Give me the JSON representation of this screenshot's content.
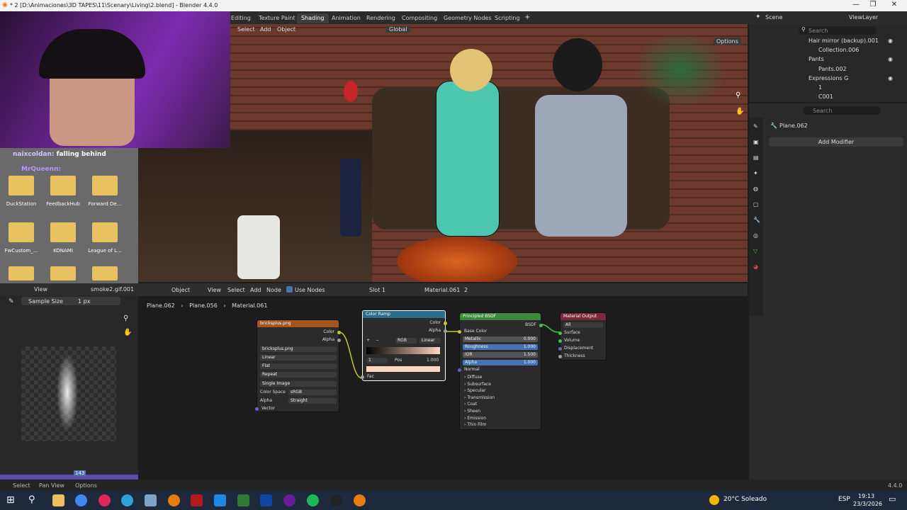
{
  "window": {
    "title": "* 2 [D:\\Animaciones\\3D TAPES\\11\\Scenary\\Living\\2.blend] - Blender 4.4.0"
  },
  "workspaces": [
    "Editing",
    "Texture Paint",
    "Shading",
    "Animation",
    "Rendering",
    "Compositing",
    "Geometry Nodes",
    "Scripting"
  ],
  "active_workspace": "Shading",
  "scene": {
    "scene_label": "Scene",
    "viewlayer_label": "ViewLayer"
  },
  "viewport_header": {
    "select": "Select",
    "add": "Add",
    "object": "Object",
    "orientation": "Global",
    "options": "Options"
  },
  "desktop_icons": [
    {
      "label": "DuckStation"
    },
    {
      "label": "FeedbackHub"
    },
    {
      "label": "Forward De..."
    },
    {
      "label": "FwCustom_..."
    },
    {
      "label": "KONAMI"
    },
    {
      "label": "League of L..."
    }
  ],
  "chat": [
    {
      "user": "naixcoldan:",
      "message": "falling behind"
    },
    {
      "user": "MrQueenn:",
      "message": ""
    }
  ],
  "image_editor": {
    "view": "View",
    "image_name": "smoke2.gif.001",
    "sample_size_label": "Sample Size",
    "sample_size_value": "1 px",
    "frame": "143"
  },
  "node_editor_header": {
    "object": "Object",
    "view": "View",
    "select": "Select",
    "add": "Add",
    "node": "Node",
    "use_nodes": "Use Nodes",
    "slot": "Slot 1",
    "material": "Material.061",
    "users": "2"
  },
  "breadcrumb": [
    "Plane.062",
    "Plane.056",
    "Material.061"
  ],
  "nodes": {
    "image_texture": {
      "title": "bricksplus.png",
      "out_color": "Color",
      "out_alpha": "Alpha",
      "image": "bricksplus.png",
      "interpolation": "Linear",
      "projection": "Flat",
      "extension": "Repeat",
      "source": "Single Image",
      "color_space_label": "Color Space",
      "color_space": "sRGB",
      "alpha_label": "Alpha",
      "alpha": "Straight",
      "in_vector": "Vector"
    },
    "color_ramp": {
      "title": "Color Ramp",
      "out_color": "Color",
      "out_alpha": "Alpha",
      "mode": "RGB",
      "interp": "Linear",
      "index": "1",
      "pos_label": "Pos",
      "pos_value": "1.000",
      "in_fac": "Fac"
    },
    "principled": {
      "title": "Principled BSDF",
      "out_bsdf": "BSDF",
      "base_color": "Base Color",
      "fields": [
        {
          "label": "Metallic",
          "value": "0.000"
        },
        {
          "label": "Roughness",
          "value": "1.000"
        },
        {
          "label": "IOR",
          "value": "1.500"
        },
        {
          "label": "Alpha",
          "value": "1.000"
        }
      ],
      "normal": "Normal",
      "panels": [
        "Diffuse",
        "Subsurface",
        "Specular",
        "Transmission",
        "Coat",
        "Sheen",
        "Emission",
        "Thin Film"
      ]
    },
    "output": {
      "title": "Material Output",
      "target": "All",
      "inputs": [
        "Surface",
        "Volume",
        "Displacement",
        "Thickness"
      ]
    }
  },
  "outliner": {
    "search_placeholder": "Search",
    "items": [
      {
        "label": "Hair mirror (backup).001"
      },
      {
        "label": "Collection.006"
      },
      {
        "label": "Pants"
      },
      {
        "label": "Pants.002"
      },
      {
        "label": "Expressions G"
      },
      {
        "label": "1"
      },
      {
        "label": "C001"
      }
    ]
  },
  "properties": {
    "search_placeholder": "Search",
    "object": "Plane.062",
    "add_modifier": "Add Modifier"
  },
  "statusbar": {
    "select": "Select",
    "pan_view": "Pan View",
    "options": "Options",
    "version": "4.4.0"
  },
  "taskbar": {
    "weather": "20°C  Soleado",
    "lang": "ESP",
    "time": "19:13",
    "date": "23/3/2026"
  },
  "colors": {
    "accent": "#4772b3",
    "node_color": "#c7c729",
    "node_shader": "#3b8a3b",
    "node_texture": "#a05522",
    "node_output": "#7a2a3a",
    "node_converter": "#2c6c8c"
  }
}
